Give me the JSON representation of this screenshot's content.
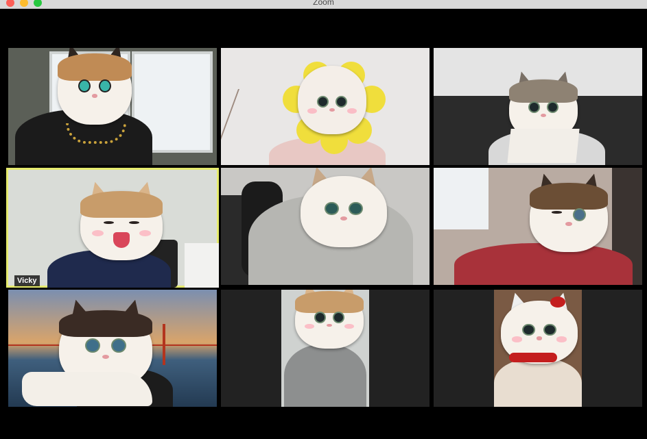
{
  "window": {
    "title": "Zoom"
  },
  "participants": [
    {
      "id": "p1",
      "name": ""
    },
    {
      "id": "p2",
      "name": ""
    },
    {
      "id": "p3",
      "name": ""
    },
    {
      "id": "p4",
      "name": "Vicky",
      "active_speaker": true
    },
    {
      "id": "p5",
      "name": ""
    },
    {
      "id": "p6",
      "name": ""
    },
    {
      "id": "p7",
      "name": ""
    },
    {
      "id": "p8",
      "name": ""
    },
    {
      "id": "p9",
      "name": ""
    }
  ],
  "colors": {
    "active_speaker_border": "#e6eb6e",
    "tile_empty": "#222222"
  }
}
